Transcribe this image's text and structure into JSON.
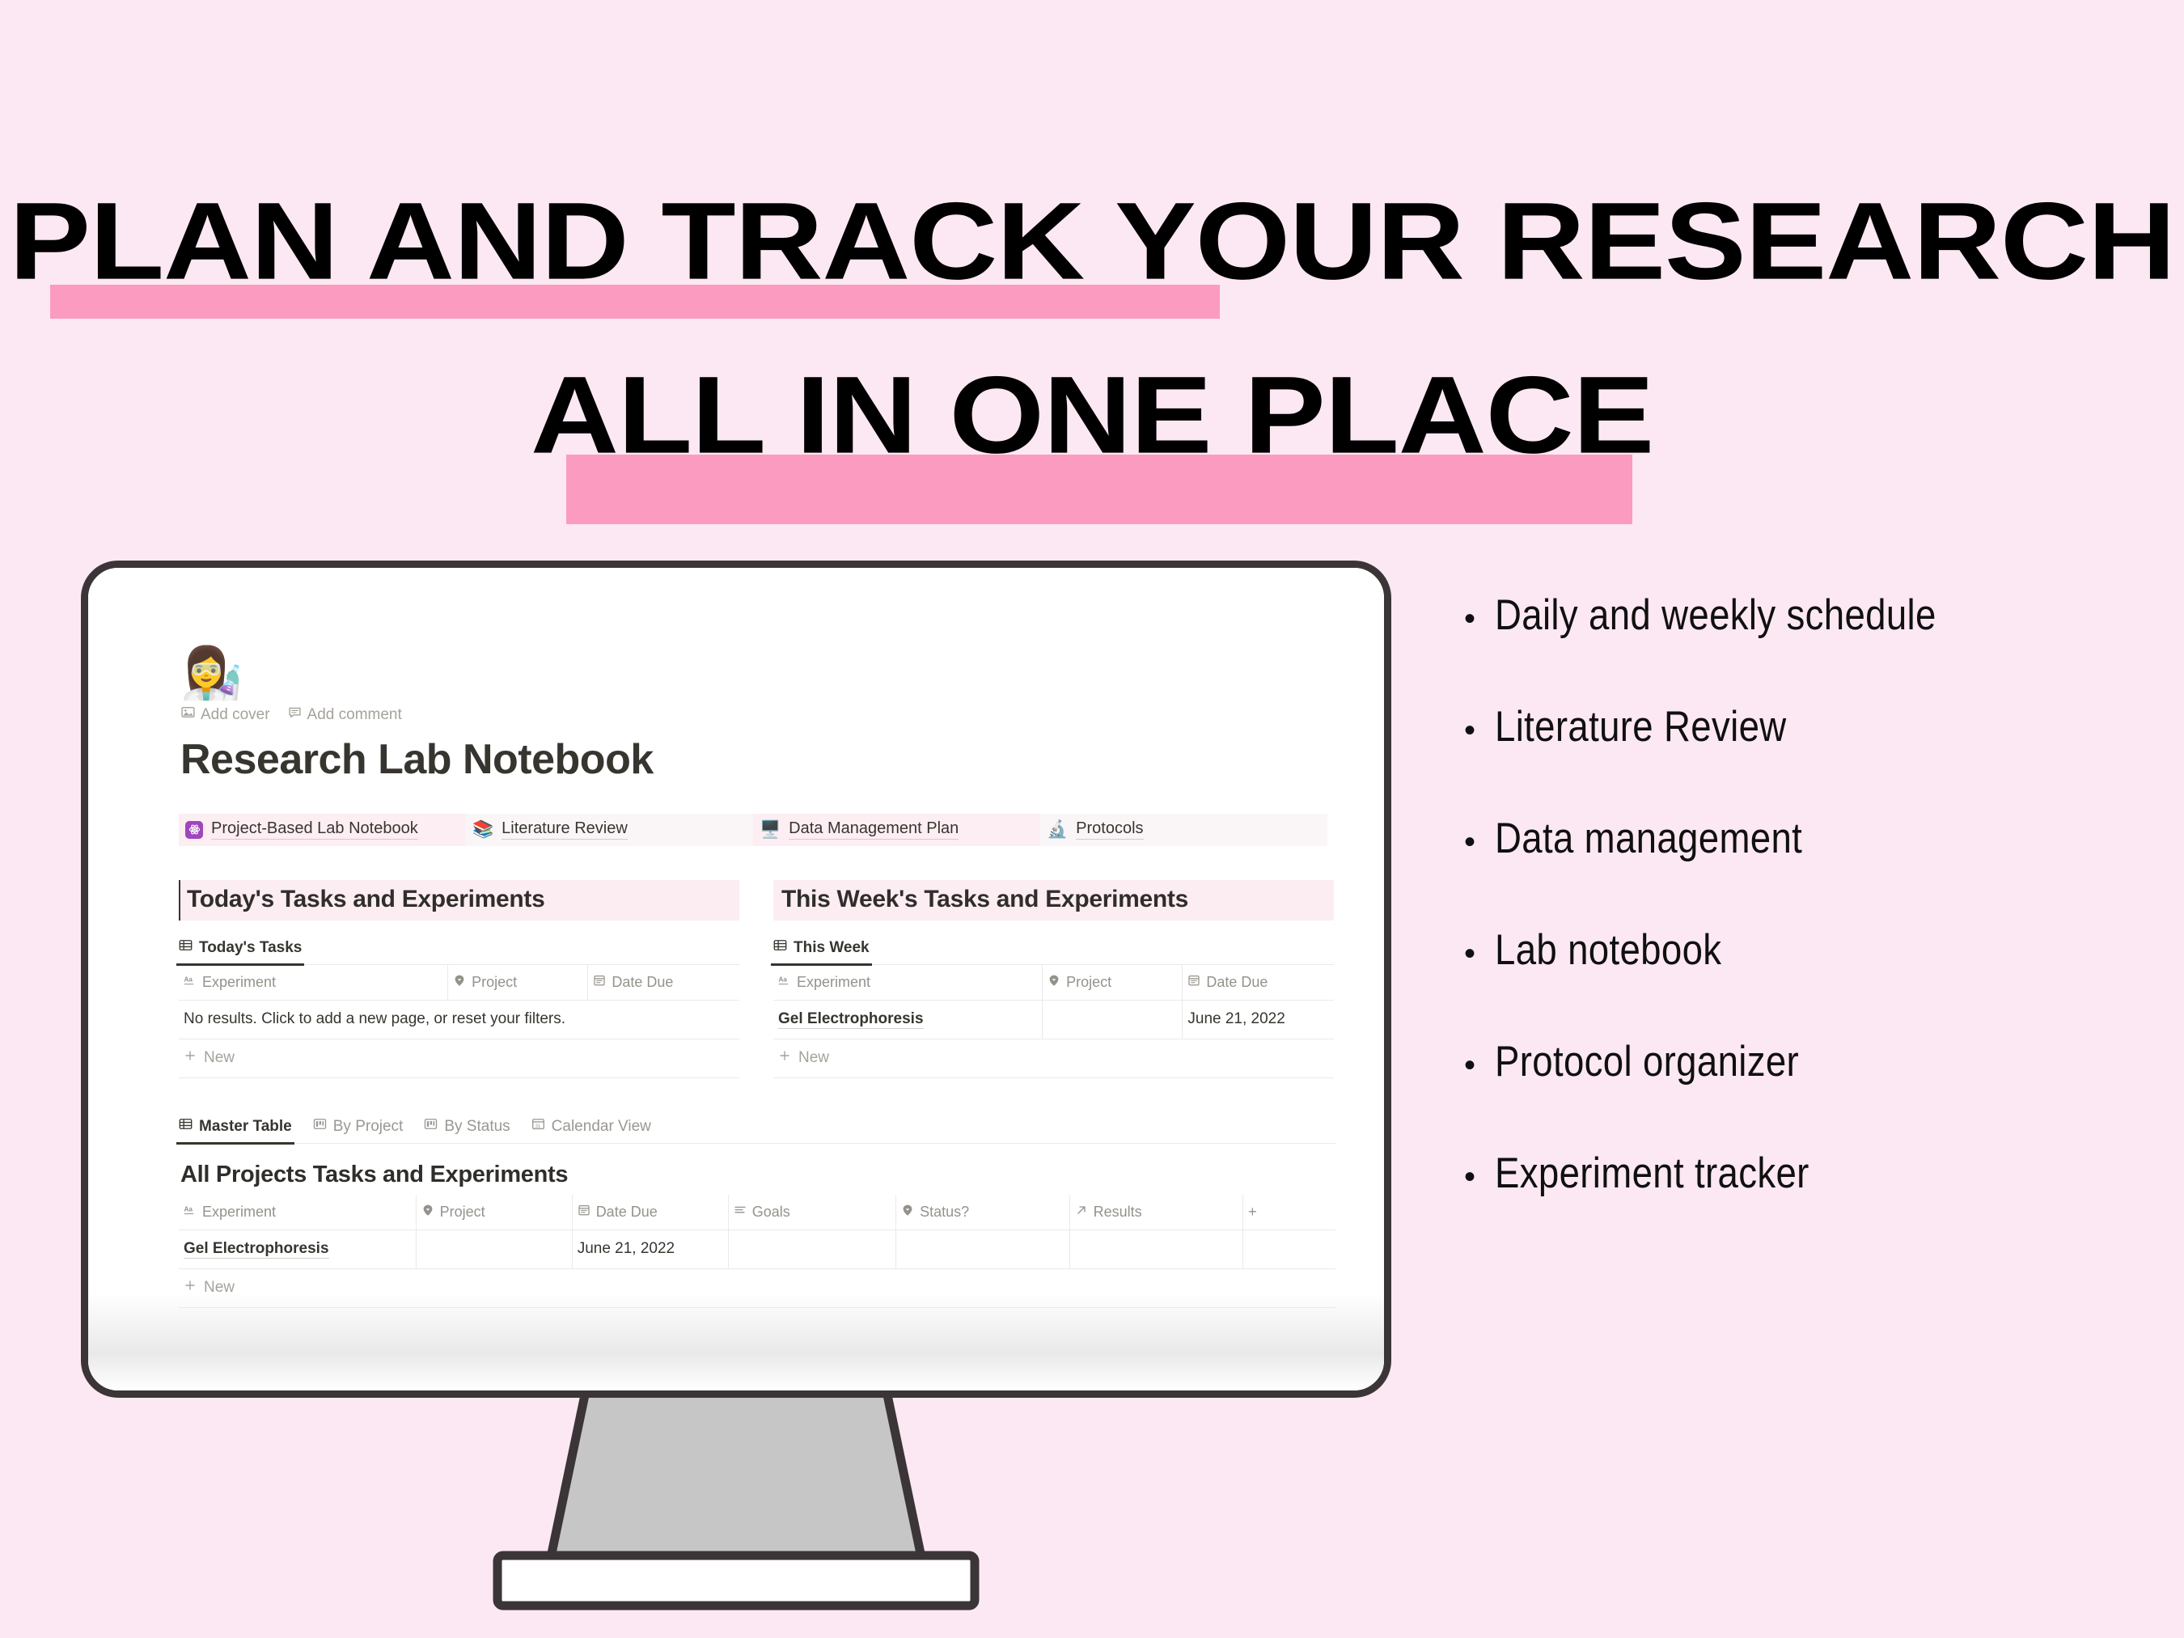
{
  "headline": {
    "line1": "PLAN AND TRACK YOUR RESEARCH",
    "line2": "ALL IN ONE PLACE"
  },
  "colors": {
    "background": "#fce8f2",
    "highlight": "#fb9bc0",
    "monitor_frame": "#3b3537",
    "stand": "#c6c6c6",
    "notion_text": "#37352f",
    "notion_muted": "#95928c",
    "section_tint": "#fcedf2",
    "atom_purple": "#9f45bd"
  },
  "notion": {
    "page_emoji": "👩‍🔬",
    "page_emoji_name": "woman-scientist-emoji",
    "actions": [
      {
        "label": "Add cover",
        "icon": "image-icon"
      },
      {
        "label": "Add comment",
        "icon": "comment-icon"
      }
    ],
    "title": "Research Lab Notebook",
    "links": [
      {
        "label": "Project-Based Lab Notebook",
        "icon": "atom-icon",
        "emoji": "",
        "tinted": true
      },
      {
        "label": "Literature Review",
        "icon": "books-emoji",
        "emoji": "📚",
        "tinted": false
      },
      {
        "label": "Data Management Plan",
        "icon": "desktop-computer-emoji",
        "emoji": "🖥️",
        "tinted": true
      },
      {
        "label": "Protocols",
        "icon": "microscope-emoji",
        "emoji": "🔬",
        "tinted": false
      }
    ],
    "today": {
      "heading": "Today's Tasks and Experiments",
      "view_tab": "Today's Tasks",
      "view_tab_icon": "table-icon",
      "columns": [
        {
          "label": "Experiment",
          "icon": "title-text-icon"
        },
        {
          "label": "Project",
          "icon": "select-icon"
        },
        {
          "label": "Date Due",
          "icon": "calendar-icon"
        }
      ],
      "empty_message": "No results. Click to add a new page, or reset your filters.",
      "rows": [],
      "new_label": "New"
    },
    "this_week": {
      "heading": "This Week's Tasks and Experiments",
      "view_tab": "This Week",
      "view_tab_icon": "table-icon",
      "columns": [
        {
          "label": "Experiment",
          "icon": "title-text-icon"
        },
        {
          "label": "Project",
          "icon": "select-icon"
        },
        {
          "label": "Date Due",
          "icon": "calendar-icon"
        }
      ],
      "rows": [
        {
          "experiment": "Gel Electrophoresis",
          "project": "",
          "date_due": "June 21, 2022"
        }
      ],
      "new_label": "New"
    },
    "master": {
      "tabs": [
        {
          "label": "Master Table",
          "icon": "table-icon",
          "active": true
        },
        {
          "label": "By Project",
          "icon": "board-icon",
          "active": false
        },
        {
          "label": "By Status",
          "icon": "board-icon",
          "active": false
        },
        {
          "label": "Calendar View",
          "icon": "calendar-view-icon",
          "active": false
        }
      ],
      "title": "All Projects Tasks and Experiments",
      "columns": [
        {
          "label": "Experiment",
          "icon": "title-text-icon"
        },
        {
          "label": "Project",
          "icon": "select-icon"
        },
        {
          "label": "Date Due",
          "icon": "calendar-icon"
        },
        {
          "label": "Goals",
          "icon": "text-lines-icon"
        },
        {
          "label": "Status?",
          "icon": "select-icon"
        },
        {
          "label": "Results",
          "icon": "arrow-up-right-icon"
        }
      ],
      "add_column_label": "+",
      "rows": [
        {
          "experiment": "Gel Electrophoresis",
          "project": "",
          "date_due": "June 21, 2022",
          "goals": "",
          "status": "",
          "results": ""
        }
      ],
      "new_label": "New"
    }
  },
  "features": [
    "Daily and weekly schedule",
    "Literature Review",
    "Data management",
    "Lab notebook",
    "Protocol organizer",
    "Experiment tracker"
  ]
}
